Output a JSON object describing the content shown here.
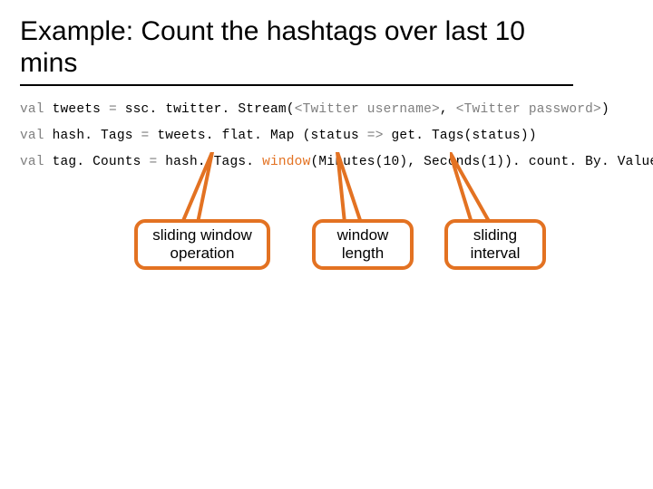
{
  "title": "Example: Count the hashtags over last 10 mins",
  "code": {
    "l1": {
      "kw": "val",
      "rest1": " tweets ",
      "op": "=",
      "rest2": " ssc. twitter. Stream(",
      "arg1": "<Twitter username>",
      "comma": ", ",
      "arg2": "<Twitter password>",
      "close": ")"
    },
    "l2": {
      "kw": "val",
      "rest1": " hash. Tags ",
      "op": "=",
      "rest2": " tweets. flat. Map (status ",
      "arrow": "=>",
      "rest3": " get. Tags(status))"
    },
    "l3": {
      "kw": "val",
      "rest1": " tag. Counts ",
      "op": "=",
      "rest2": " hash. Tags. ",
      "window": "window",
      "paren_open": "(",
      "arg_min": "Minutes(10)",
      "comma": ", ",
      "arg_sec": "Seconds(1)",
      "paren_close": ")",
      "rest3": ". count. By. Value()"
    }
  },
  "callouts": {
    "c1": "sliding window operation",
    "c2": "window length",
    "c3": "sliding interval"
  },
  "colors": {
    "accent": "#e37222",
    "muted": "#7f7f7f"
  }
}
